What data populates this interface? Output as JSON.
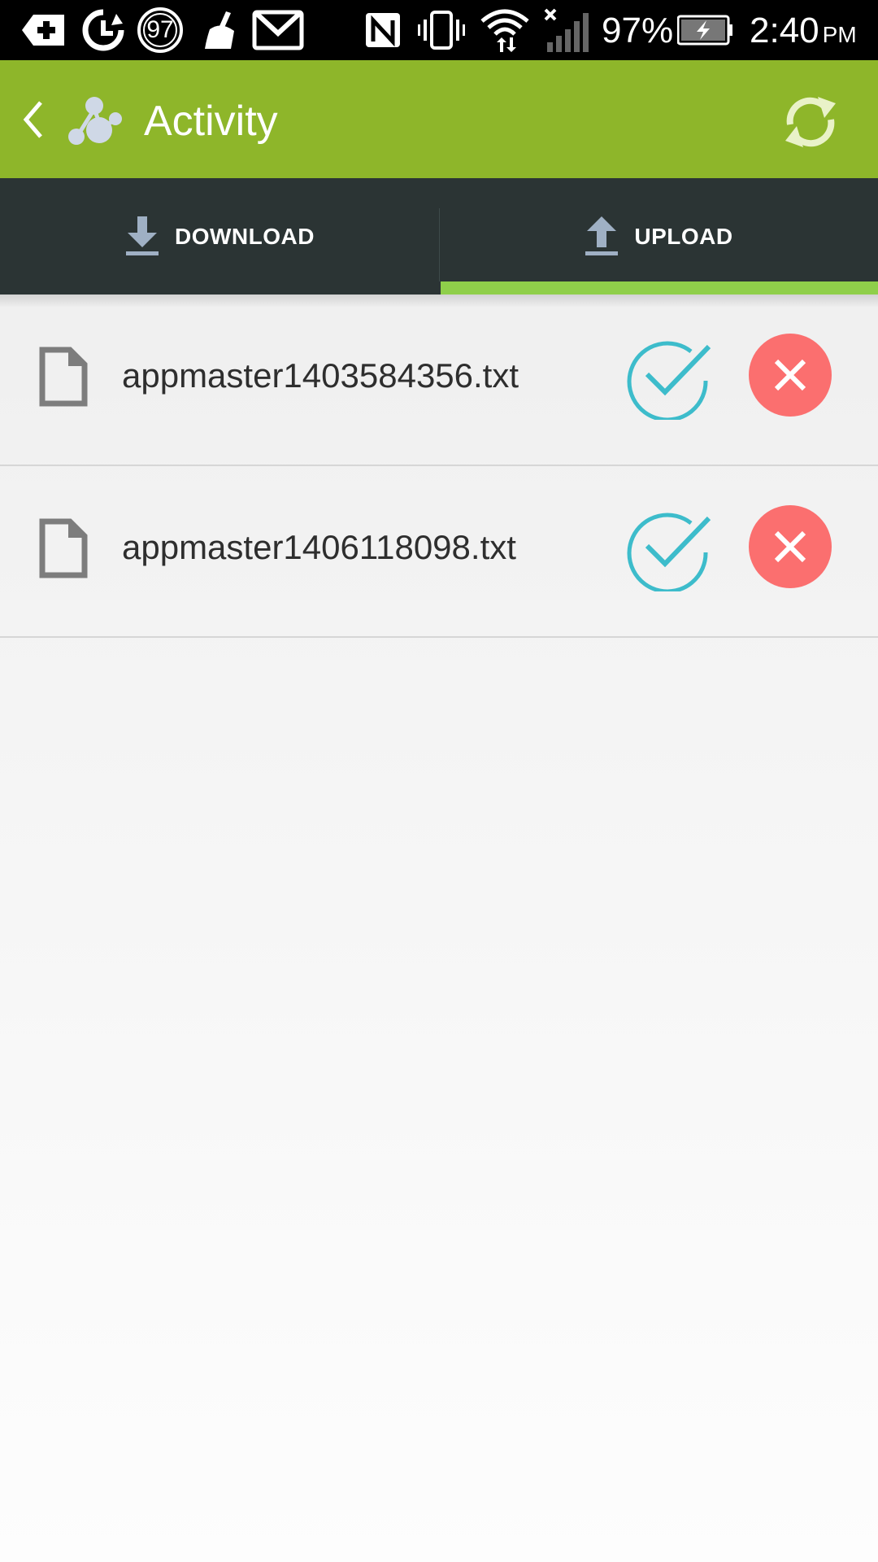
{
  "status_bar": {
    "notification_badge": "97",
    "battery_percent": "97%",
    "time": "2:40",
    "time_suffix": "PM"
  },
  "app_bar": {
    "title": "Activity"
  },
  "tabs": [
    {
      "label": "DOWNLOAD",
      "icon": "download-icon",
      "selected": false
    },
    {
      "label": "UPLOAD",
      "icon": "upload-icon",
      "selected": true
    }
  ],
  "files": [
    {
      "name": "appmaster1403584356.txt"
    },
    {
      "name": "appmaster1406118098.txt"
    }
  ],
  "colors": {
    "app_bar": "#8eb62a",
    "tab_bar": "#2b3434",
    "tab_indicator": "#8fcf4a",
    "accept": "#3dbccb",
    "reject": "#fb6f6f"
  }
}
